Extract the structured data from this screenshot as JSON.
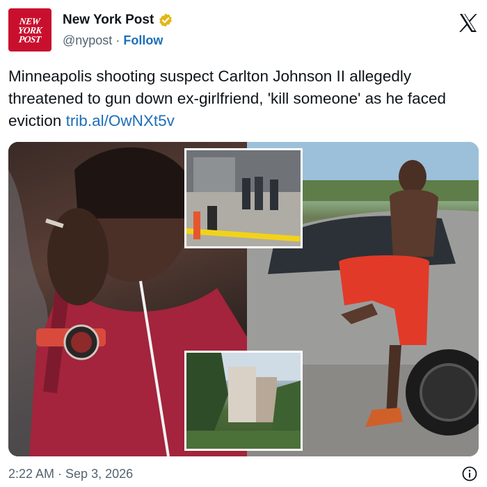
{
  "account": {
    "logo_lines": [
      "NEW",
      "YORK",
      "POST"
    ],
    "name": "New York Post",
    "handle": "@nypost",
    "separator": "·",
    "follow_label": "Follow",
    "verified_color": "#e2b719"
  },
  "tweet": {
    "text": "Minneapolis shooting suspect Carlton Johnson II allegedly threatened to gun down ex-girlfriend, 'kill someone' as he faced eviction",
    "link": "trib.al/OwNXt5v"
  },
  "media": {
    "images": [
      "portrait-photo-smoking",
      "shooting-scene-photo",
      "man-leaning-on-car-photo",
      "apartment-building-photo"
    ]
  },
  "footer": {
    "timestamp": "2:22 AM · Sep 3, 2026"
  },
  "colors": {
    "brand_red": "#c8102e",
    "link_blue": "#1d6fb8",
    "muted_gray": "#536471"
  }
}
